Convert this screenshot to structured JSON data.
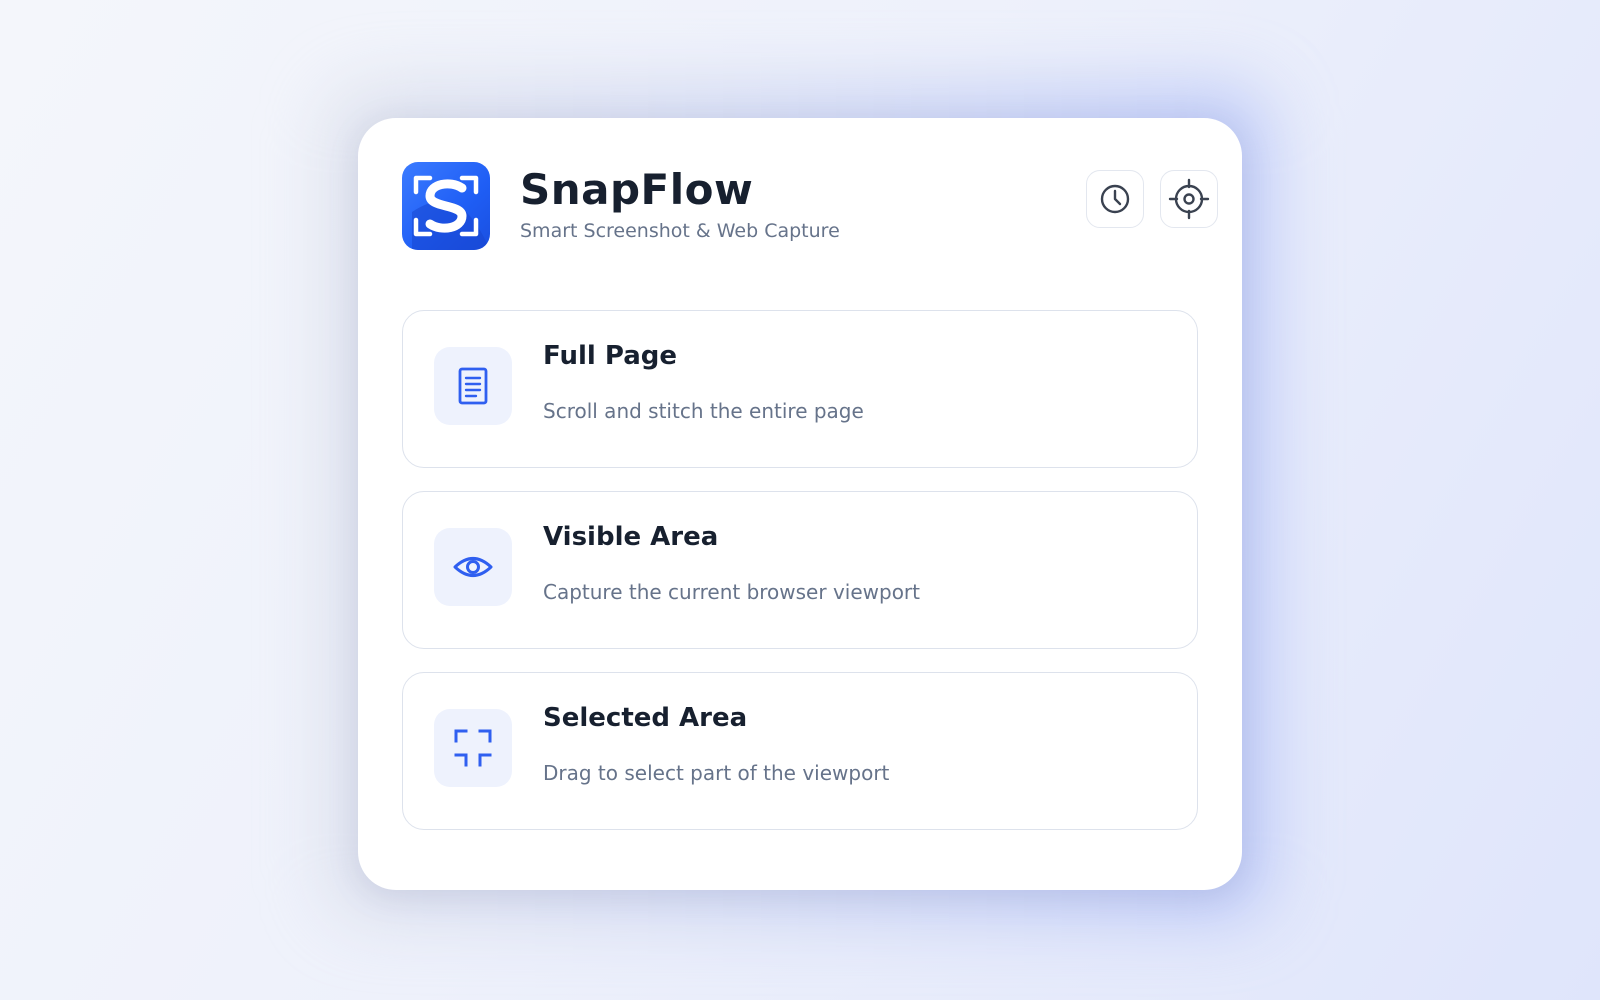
{
  "app": {
    "title": "SnapFlow",
    "subtitle": "Smart Screenshot & Web Capture",
    "logo_icon": "snapflow-logo"
  },
  "header_actions": [
    {
      "icon": "clock-icon",
      "purpose": "history"
    },
    {
      "icon": "target-icon",
      "purpose": "capture-target"
    }
  ],
  "options": [
    {
      "title": "Full Page",
      "description": "Scroll and stitch the entire page",
      "icon": "document-icon"
    },
    {
      "title": "Visible Area",
      "description": "Capture the current browser viewport",
      "icon": "eye-icon"
    },
    {
      "title": "Selected Area",
      "description": "Drag to select part of the viewport",
      "icon": "selection-corners-icon"
    }
  ],
  "colors": {
    "accent": "#2f5ff0",
    "logo": "#2563f5",
    "text_primary": "#17202f",
    "text_secondary": "#66738a",
    "icon_bg": "#eef2fd",
    "border": "#dde2ec"
  }
}
